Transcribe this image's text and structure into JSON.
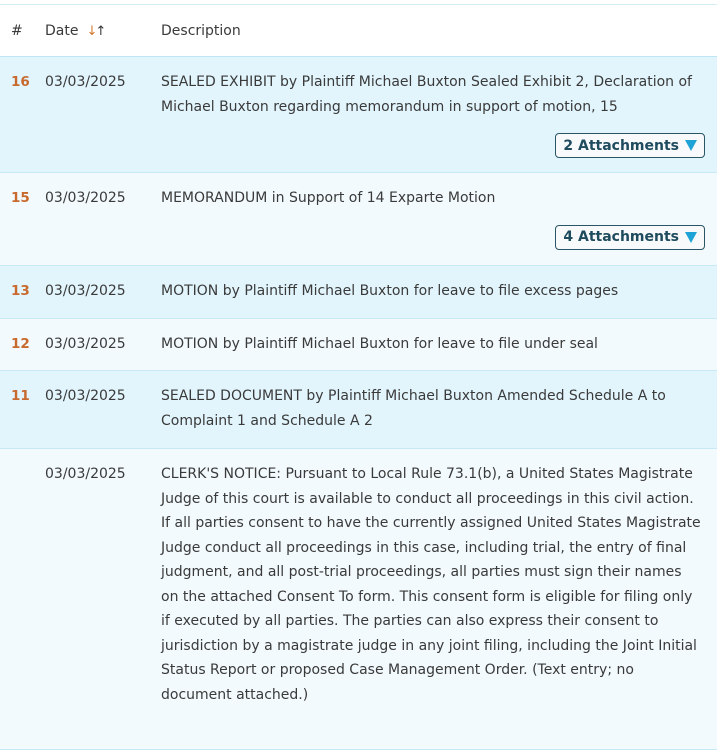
{
  "header": {
    "num": "#",
    "date": "Date",
    "description": "Description"
  },
  "rows": [
    {
      "num": "16",
      "date": "03/03/2025",
      "description": "SEALED EXHIBIT by Plaintiff Michael Buxton Sealed Exhibit 2, Declaration of Michael Buxton regarding memorandum in support of motion, 15",
      "attachments": "2 Attachments"
    },
    {
      "num": "15",
      "date": "03/03/2025",
      "description": "MEMORANDUM in Support of 14 Exparte Motion",
      "attachments": "4 Attachments"
    },
    {
      "num": "13",
      "date": "03/03/2025",
      "description": "MOTION by Plaintiff Michael Buxton for leave to file excess pages"
    },
    {
      "num": "12",
      "date": "03/03/2025",
      "description": "MOTION by Plaintiff Michael Buxton for leave to file under seal"
    },
    {
      "num": "11",
      "date": "03/03/2025",
      "description": "SEALED DOCUMENT by Plaintiff Michael Buxton Amended Schedule A to Complaint 1 and Schedule A 2"
    },
    {
      "num": "",
      "date": "03/03/2025",
      "description": "CLERK'S NOTICE: Pursuant to Local Rule 73.1(b), a United States Magistrate Judge of this court is available to conduct all proceedings in this civil action. If all parties consent to have the currently assigned United States Magistrate Judge conduct all proceedings in this case, including trial, the entry of final judgment, and all post-trial proceedings, all parties must sign their names on the attached Consent To form. This consent form is eligible for filing only if executed by all parties. The parties can also express their consent to jurisdiction by a magistrate judge in any joint filing, including the Joint Initial Status Report or proposed Case Management Order. (Text entry; no document attached.)"
    }
  ]
}
